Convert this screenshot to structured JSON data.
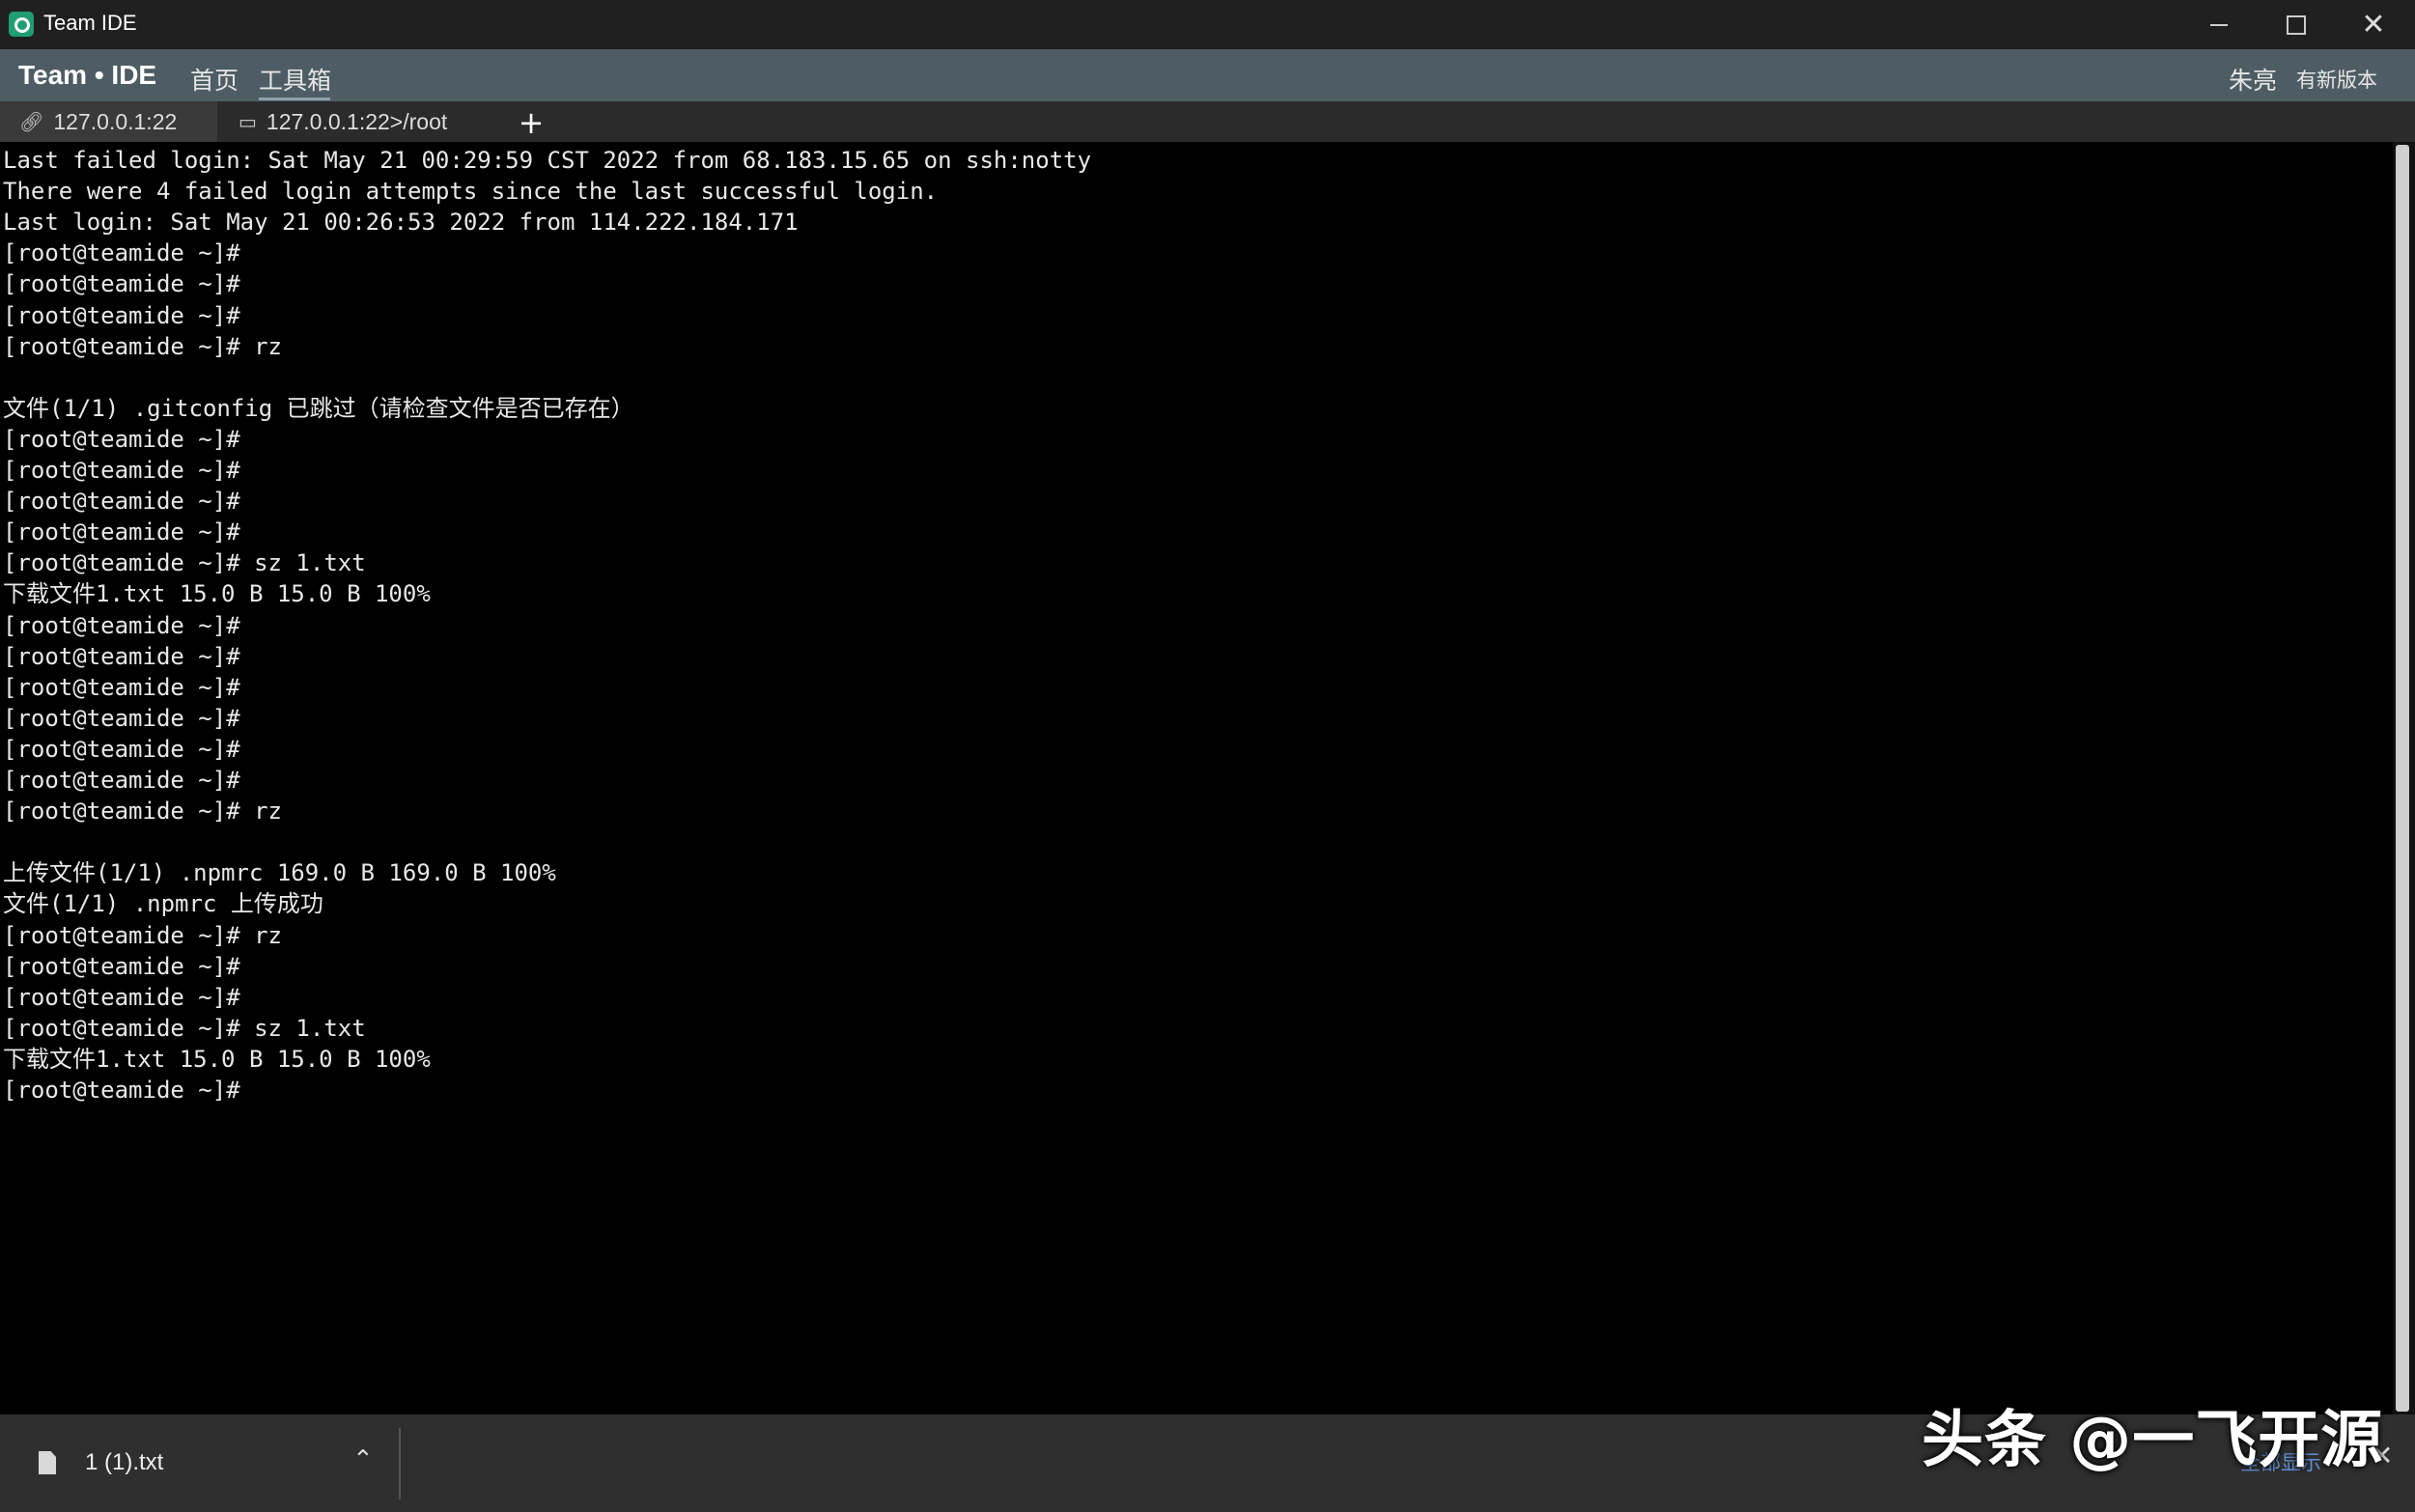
{
  "window": {
    "title": "Team IDE",
    "controls": {
      "minimize": "—",
      "maximize": "□",
      "close": "✕"
    }
  },
  "menubar": {
    "brand": "Team • IDE",
    "items": [
      "首页",
      "工具箱"
    ],
    "user": "朱亮",
    "new_version": "有新版本"
  },
  "tabs": [
    {
      "icon": "link-icon",
      "label": "127.0.0.1:22"
    },
    {
      "icon": "terminal-icon",
      "label": "127.0.0.1:22>/root"
    }
  ],
  "tab_add_label": "+",
  "terminal": {
    "lines": [
      "Last failed login: Sat May 21 00:29:59 CST 2022 from 68.183.15.65 on ssh:notty",
      "There were 4 failed login attempts since the last successful login.",
      "Last login: Sat May 21 00:26:53 2022 from 114.222.184.171",
      "[root@teamide ~]#",
      "[root@teamide ~]#",
      "[root@teamide ~]#",
      "[root@teamide ~]# rz",
      "",
      "文件(1/1) .gitconfig 已跳过（请检查文件是否已存在）",
      "[root@teamide ~]#",
      "[root@teamide ~]#",
      "[root@teamide ~]#",
      "[root@teamide ~]#",
      "[root@teamide ~]# sz 1.txt",
      "下载文件1.txt 15.0 B 15.0 B 100%",
      "[root@teamide ~]#",
      "[root@teamide ~]#",
      "[root@teamide ~]#",
      "[root@teamide ~]#",
      "[root@teamide ~]#",
      "[root@teamide ~]#",
      "[root@teamide ~]# rz",
      "",
      "上传文件(1/1) .npmrc 169.0 B 169.0 B 100%",
      "文件(1/1) .npmrc 上传成功",
      "[root@teamide ~]# rz",
      "[root@teamide ~]#",
      "[root@teamide ~]#",
      "[root@teamide ~]# sz 1.txt",
      "下载文件1.txt 15.0 B 15.0 B 100%",
      "[root@teamide ~]#"
    ]
  },
  "downloads": {
    "file_name": "1 (1).txt",
    "show_all": "全部显示",
    "close": "✕"
  },
  "watermark": "头条 @一飞开源"
}
